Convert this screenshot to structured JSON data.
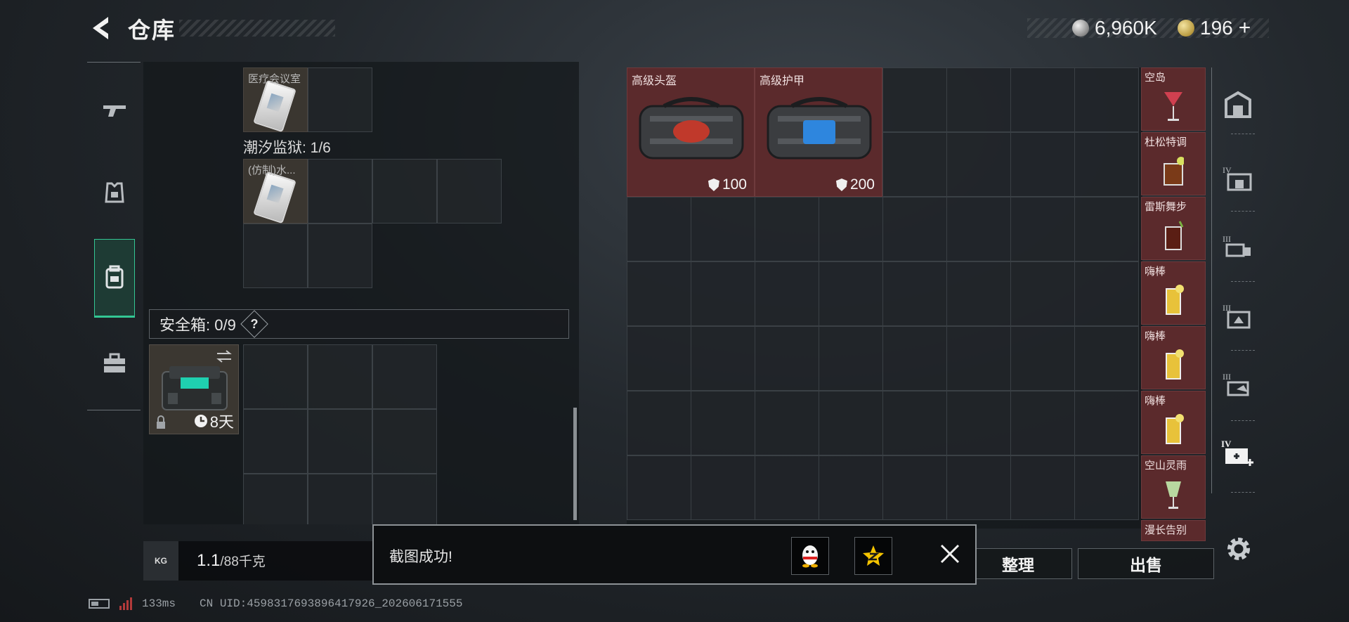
{
  "header": {
    "title": "仓库",
    "currency": [
      {
        "name": "silver-coin",
        "value": "6,960K"
      },
      {
        "name": "gold-coin",
        "value": "196"
      }
    ],
    "add_label": "+"
  },
  "left_rail": {
    "items": [
      {
        "name": "weapon-icon"
      },
      {
        "name": "armor-icon"
      },
      {
        "name": "backpack-icon",
        "active": true
      },
      {
        "name": "toolbox-icon"
      }
    ]
  },
  "inventory": {
    "item_medical": {
      "label": "医疗会议室"
    },
    "section_prison": {
      "label": "潮汐监狱: 1/6"
    },
    "item_imitation": {
      "label": "(仿制)水..."
    },
    "safe": {
      "label": "安全箱: 0/9",
      "help": "?",
      "duration": "8天"
    }
  },
  "weight": {
    "icon": "KG",
    "current": "1.1",
    "max": "/88千克"
  },
  "warehouse": {
    "items": [
      {
        "label": "高级头盔",
        "value": "100",
        "accent": "#c0392b"
      },
      {
        "label": "高级护甲",
        "value": "200",
        "accent": "#2e86de"
      }
    ],
    "drinks": [
      {
        "label": "空岛",
        "color": "#d04050"
      },
      {
        "label": "杜松特调",
        "color": "#7a3a18"
      },
      {
        "label": "雷斯舞步",
        "color": "#5a1e14"
      },
      {
        "label": "嗨棒",
        "color": "#e8c23a"
      },
      {
        "label": "嗨棒",
        "color": "#e8c23a"
      },
      {
        "label": "嗨棒",
        "color": "#e8c23a"
      },
      {
        "label": "空山灵雨",
        "color": "#b8d8a0"
      },
      {
        "label": "漫长告别",
        "color": "#c8d898"
      }
    ]
  },
  "right_rail": {
    "items": [
      {
        "name": "vault-icon"
      },
      {
        "name": "tier-iv-container-icon",
        "tier": "IV"
      },
      {
        "name": "tier-iii-truck-icon",
        "tier": "III"
      },
      {
        "name": "tier-iii-crate-icon",
        "tier": "III"
      },
      {
        "name": "tier-iii-hand-icon",
        "tier": "III"
      },
      {
        "name": "tier-iv-medkit-icon",
        "tier": "IV"
      }
    ]
  },
  "buttons": {
    "organize": "整理",
    "sell": "出售"
  },
  "toast": {
    "message": "截图成功!",
    "icons": [
      "qq-icon",
      "qzone-icon"
    ]
  },
  "status": {
    "ping": "133ms",
    "uid": "CN UID:4598317693896417926_202606171555"
  }
}
